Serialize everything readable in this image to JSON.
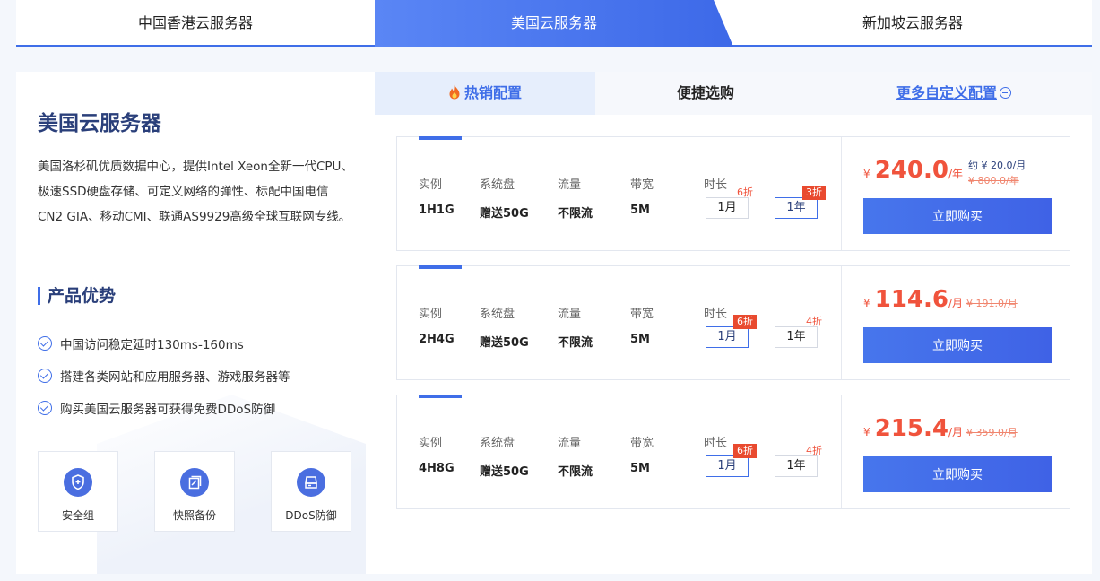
{
  "region_tabs": [
    "中国香港云服务器",
    "美国云服务器",
    "新加坡云服务器"
  ],
  "left": {
    "title": "美国云服务器",
    "description": "美国洛杉矶优质数据中心，提供Intel Xeon全新一代CPU、极速SSD硬盘存储、可定义网络的弹性、标配中国电信CN2 GIA、移动CMI、联通AS9929高级全球互联网专线。",
    "advantages_title": "产品优势",
    "features": [
      "中国访问稳定延时130ms-160ms",
      "搭建各类网站和应用服务器、游戏服务器等",
      "购买美国云服务器可获得免费DDoS防御"
    ],
    "products": [
      {
        "label": "安全组",
        "icon": "shield-icon"
      },
      {
        "label": "快照备份",
        "icon": "snapshot-icon"
      },
      {
        "label": "DDoS防御",
        "icon": "disk-icon"
      }
    ]
  },
  "sub_tabs": {
    "hot": "热销配置",
    "quick": "便捷选购",
    "custom": "更多自定义配置"
  },
  "spec_headers": {
    "instance": "实例",
    "disk": "系统盘",
    "traffic": "流量",
    "bandwidth": "带宽",
    "duration": "时长"
  },
  "plans": [
    {
      "instance": "1H1G",
      "disk": "赠送50G",
      "traffic": "不限流",
      "bandwidth": "5M",
      "month_label": "1月",
      "month_discount": "6折",
      "year_label": "1年",
      "year_discount": "3折",
      "active": "year",
      "currency": "¥",
      "price": "240.0",
      "unit": "/年",
      "orig_price": "¥ 800.0/年",
      "approx": "约 ¥ 20.0/月",
      "buy_label": "立即购买"
    },
    {
      "instance": "2H4G",
      "disk": "赠送50G",
      "traffic": "不限流",
      "bandwidth": "5M",
      "month_label": "1月",
      "month_discount": "6折",
      "year_label": "1年",
      "year_discount": "4折",
      "active": "month",
      "currency": "¥",
      "price": "114.6",
      "unit": "/月",
      "orig_price": "¥ 191.0/月",
      "approx": "",
      "buy_label": "立即购买"
    },
    {
      "instance": "4H8G",
      "disk": "赠送50G",
      "traffic": "不限流",
      "bandwidth": "5M",
      "month_label": "1月",
      "month_discount": "6折",
      "year_label": "1年",
      "year_discount": "4折",
      "active": "month",
      "currency": "¥",
      "price": "215.4",
      "unit": "/月",
      "orig_price": "¥ 359.0/月",
      "approx": "",
      "buy_label": "立即购买"
    }
  ],
  "colors": {
    "accent": "#3f6ee8",
    "price": "#f0533c",
    "title": "#2a3f7a"
  }
}
